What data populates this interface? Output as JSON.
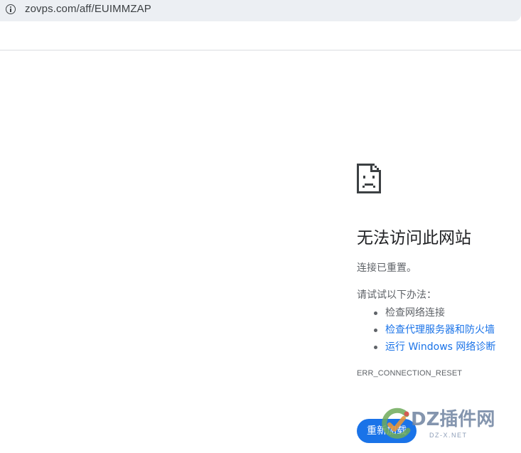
{
  "address_bar": {
    "url": "zovps.com/aff/EUIMMZAP",
    "icon": "info-icon"
  },
  "error_page": {
    "icon": "sad-page-icon",
    "title": "无法访问此网站",
    "subtitle": "连接已重置。",
    "try_label": "请试试以下办法：",
    "suggestions": [
      {
        "label": "检查网络连接",
        "is_link": false
      },
      {
        "label": "检查代理服务器和防火墙",
        "is_link": true
      },
      {
        "label": "运行 Windows 网络诊断",
        "is_link": true
      }
    ],
    "error_code": "ERR_CONNECTION_RESET",
    "reload_label": "重新加载"
  },
  "watermark": {
    "text": "DZ插件网",
    "subtext": "DZ-X.NET"
  },
  "colors": {
    "accent": "#1a73e8",
    "text_primary": "#202124",
    "text_secondary": "#5f6368",
    "address_bar_bg": "#eceff3"
  }
}
